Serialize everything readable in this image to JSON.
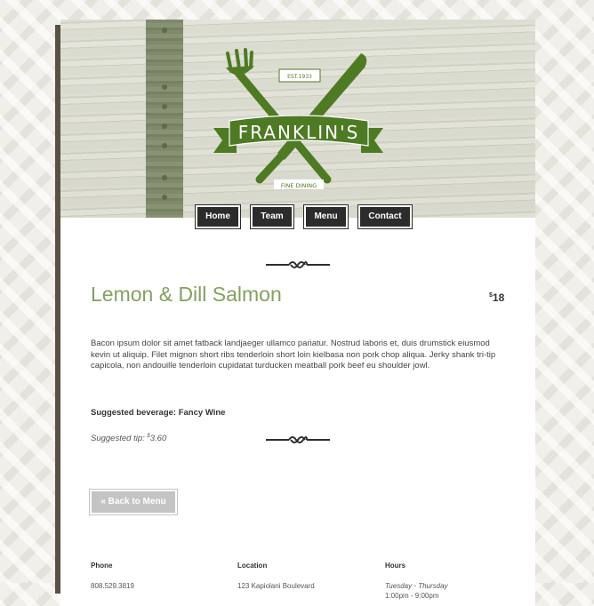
{
  "brand": {
    "name": "FRANKLIN'S",
    "est": "EST.1933",
    "tagline": "FINE DINING",
    "color": "#4e7a24"
  },
  "nav": {
    "items": [
      {
        "label": "Home"
      },
      {
        "label": "Team"
      },
      {
        "label": "Menu"
      },
      {
        "label": "Contact"
      }
    ]
  },
  "dish": {
    "name": "Lemon & Dill Salmon",
    "price_symbol": "$",
    "price": "18",
    "description": "Bacon ipsum dolor sit amet fatback landjaeger ullamco pariatur. Nostrud laboris et, duis drumstick eiusmod kevin ut aliquip. Filet mignon short ribs tenderloin short loin kielbasa non pork chop aliqua. Jerky shank tri-tip capicola, non andouille tenderloin cupidatat turducken meatball pork beef eu shoulder jowl.",
    "beverage_label": "Suggested beverage: Fancy Wine",
    "tip_label": "Suggested tip:",
    "tip_symbol": "$",
    "tip_amount": "3.60"
  },
  "back_button": {
    "label": "« Back to Menu"
  },
  "footer": {
    "phone_heading": "Phone",
    "phone": "808.529.3819",
    "location_heading": "Location",
    "location": "123 Kapiolani Boulevard",
    "hours_heading": "Hours",
    "hours_days": "Tuesday - Thursday",
    "hours_time": "1:00pm - 9:00pm"
  },
  "colors": {
    "accent": "#84a05e",
    "nav_bg": "#2c2c2c",
    "button_disabled": "#c4c4c4"
  }
}
